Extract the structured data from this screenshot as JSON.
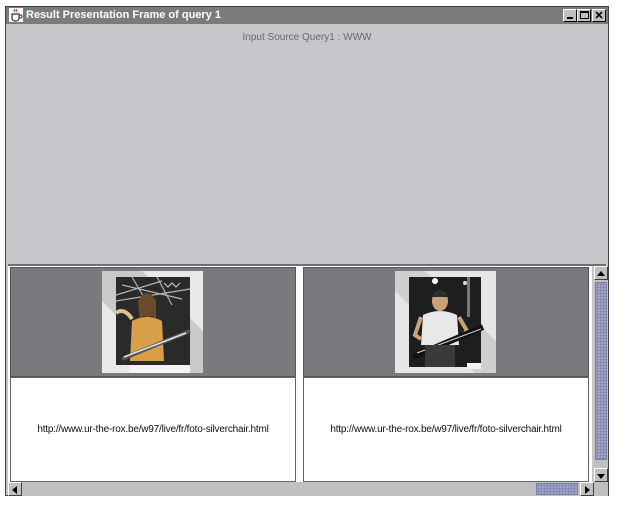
{
  "window": {
    "title": "Result Presentation Frame of query 1",
    "icon": "java-coffee-cup-icon",
    "controls": [
      "minimize-icon",
      "maximize-icon",
      "close-icon"
    ]
  },
  "top_panel": {
    "source_label": "Input Source Query1 : WWW"
  },
  "results": [
    {
      "image": "concert-photo-guitarist-long-hair",
      "caption": "http://www.ur-the-rox.be/w97/live/fr/foto-silverchair.html"
    },
    {
      "image": "concert-photo-guitarist-short-hair",
      "caption": "http://www.ur-the-rox.be/w97/live/fr/foto-silverchair.html"
    }
  ],
  "scrollbars": {
    "vertical": [
      "up-arrow-icon",
      "down-arrow-icon"
    ],
    "horizontal": [
      "left-arrow-icon",
      "right-arrow-icon"
    ]
  },
  "colors": {
    "titlebar": "#7b7b7b",
    "panel": "#c8c6cb",
    "image_cell": "#7b797e",
    "scroll_thumb": "#9fa3c8"
  }
}
